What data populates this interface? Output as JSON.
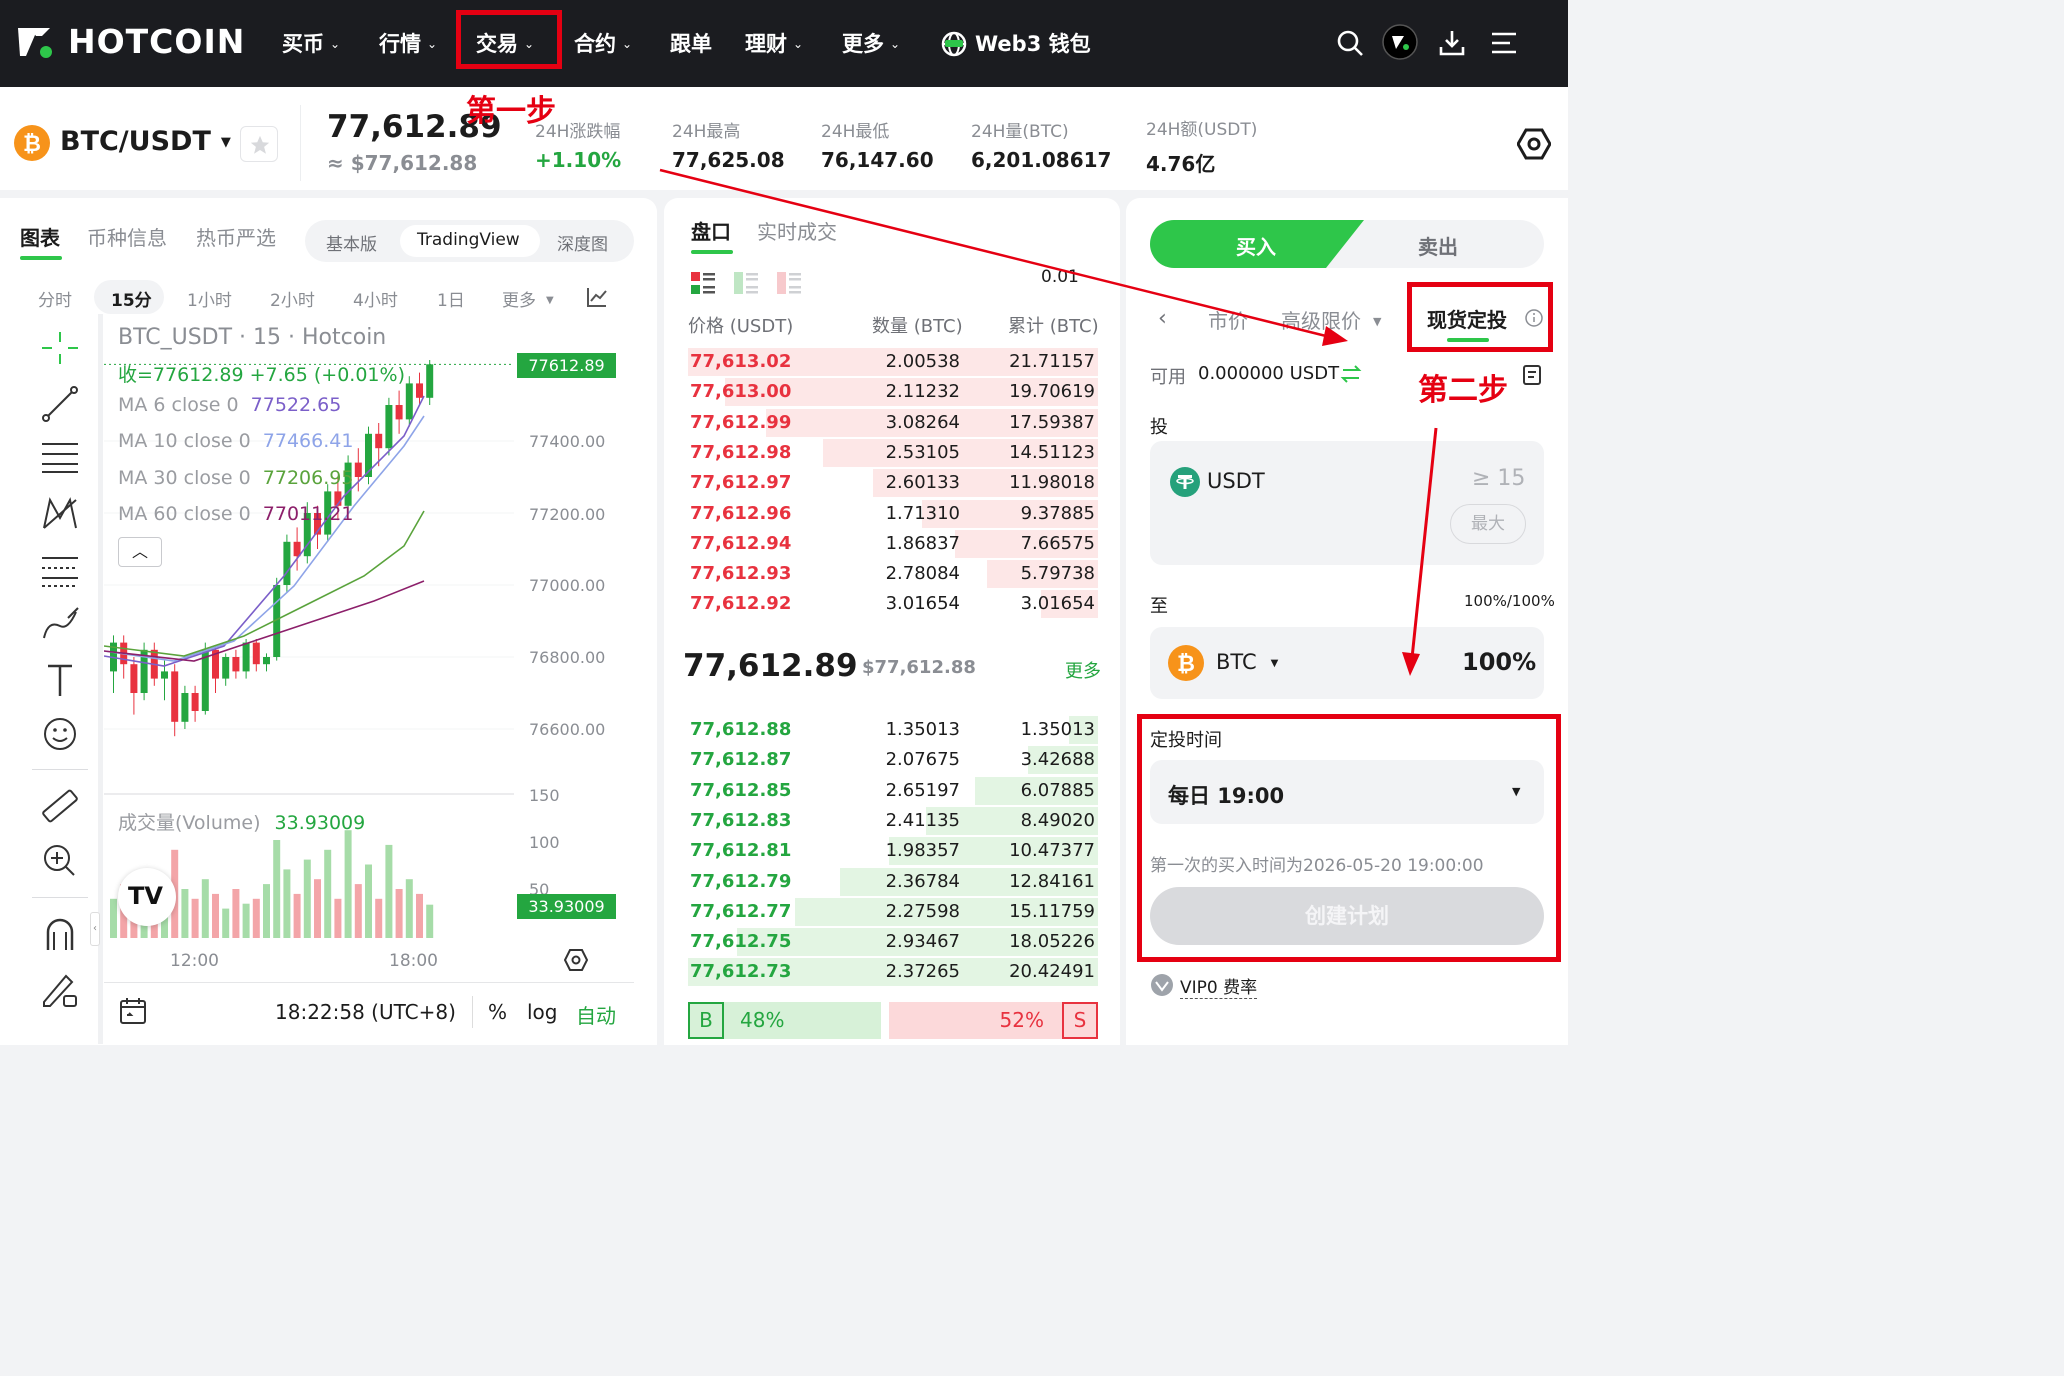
{
  "nav": {
    "logo": "HOTCOIN",
    "items": [
      {
        "label": "买币",
        "has_menu": true
      },
      {
        "label": "行情",
        "has_menu": true
      },
      {
        "label": "交易",
        "has_menu": true
      },
      {
        "label": "合约",
        "has_menu": true
      },
      {
        "label": "跟单",
        "has_menu": false
      },
      {
        "label": "理财",
        "has_menu": true
      },
      {
        "label": "更多",
        "has_menu": true
      }
    ],
    "web3_wallet": "Web3 钱包",
    "chevron": "⌄"
  },
  "annotations": {
    "step1": "第一步",
    "step2": "第二步"
  },
  "ticker": {
    "pair": "BTC/USDT",
    "last_price": "77,612.89",
    "last_price_usd": "≈ $77,612.88",
    "change_label": "24H涨跌幅",
    "change_value": "+1.10%",
    "high_label": "24H最高",
    "high_value": "77,625.08",
    "low_label": "24H最低",
    "low_value": "76,147.60",
    "vol_btc_label": "24H量(BTC)",
    "vol_btc_value": "6,201.08617",
    "vol_usdt_label": "24H额(USDT)",
    "vol_usdt_value": "4.76亿"
  },
  "chart_panel": {
    "tabs": [
      "图表",
      "币种信息",
      "热币严选"
    ],
    "views": [
      "基本版",
      "TradingView",
      "深度图"
    ],
    "active_view": "TradingView",
    "timeframes": [
      "分时",
      "15分",
      "1小时",
      "2小时",
      "4小时",
      "1日",
      "更多"
    ],
    "active_timeframe": "15分",
    "symbol_title": "BTC_USDT · 15 · Hotcoin",
    "ohlc_line": "收=77612.89 +7.65 (+0.01%)",
    "ma": [
      {
        "label": "MA 6 close 0",
        "value": "77522.65",
        "color": "#7b5fc9"
      },
      {
        "label": "MA 10 close 0",
        "value": "77466.41",
        "color": "#8ea4e8"
      },
      {
        "label": "MA 30 close 0",
        "value": "77206.95",
        "color": "#5aa33c"
      },
      {
        "label": "MA 60 close 0",
        "value": "77011.21",
        "color": "#8c1f6a"
      }
    ],
    "price_axis": [
      "77400.00",
      "77200.00",
      "77000.00",
      "76800.00",
      "76600.00"
    ],
    "price_tag": "77612.89",
    "volume_label": "成交量(Volume)",
    "volume_value": "33.93009",
    "volume_axis": [
      "150",
      "100",
      "50"
    ],
    "volume_tag": "33.93009",
    "time_axis": [
      "12:00",
      "18:00"
    ],
    "clock": "18:22:58 (UTC+8)",
    "bottom_controls": [
      "%",
      "log",
      "自动"
    ]
  },
  "orderbook": {
    "tabs": [
      "盘口",
      "实时成交"
    ],
    "precision": "0.01",
    "headers": [
      "价格 (USDT)",
      "数量 (BTC)",
      "累计 (BTC)"
    ],
    "asks": [
      {
        "price": "77,613.02",
        "qty": "2.00538",
        "total": "21.71157",
        "depth": 1.0
      },
      {
        "price": "77,613.00",
        "qty": "2.11232",
        "total": "19.70619",
        "depth": 0.91
      },
      {
        "price": "77,612.99",
        "qty": "3.08264",
        "total": "17.59387",
        "depth": 0.81
      },
      {
        "price": "77,612.98",
        "qty": "2.53105",
        "total": "14.51123",
        "depth": 0.67
      },
      {
        "price": "77,612.97",
        "qty": "2.60133",
        "total": "11.98018",
        "depth": 0.55
      },
      {
        "price": "77,612.96",
        "qty": "1.71310",
        "total": "9.37885",
        "depth": 0.43
      },
      {
        "price": "77,612.94",
        "qty": "1.86837",
        "total": "7.66575",
        "depth": 0.35
      },
      {
        "price": "77,612.93",
        "qty": "2.78084",
        "total": "5.79738",
        "depth": 0.27
      },
      {
        "price": "77,612.92",
        "qty": "3.01654",
        "total": "3.01654",
        "depth": 0.14
      }
    ],
    "mid_price": "77,612.89",
    "mid_price_usd": "$77,612.88",
    "more": "更多",
    "bids": [
      {
        "price": "77,612.88",
        "qty": "1.35013",
        "total": "1.35013",
        "depth": 0.07
      },
      {
        "price": "77,612.87",
        "qty": "2.07675",
        "total": "3.42688",
        "depth": 0.17
      },
      {
        "price": "77,612.85",
        "qty": "2.65197",
        "total": "6.07885",
        "depth": 0.3
      },
      {
        "price": "77,612.83",
        "qty": "2.41135",
        "total": "8.49020",
        "depth": 0.42
      },
      {
        "price": "77,612.81",
        "qty": "1.98357",
        "total": "10.47377",
        "depth": 0.51
      },
      {
        "price": "77,612.79",
        "qty": "2.36784",
        "total": "12.84161",
        "depth": 0.63
      },
      {
        "price": "77,612.77",
        "qty": "2.27598",
        "total": "15.11759",
        "depth": 0.74
      },
      {
        "price": "77,612.75",
        "qty": "2.93467",
        "total": "18.05226",
        "depth": 0.88
      },
      {
        "price": "77,612.73",
        "qty": "2.37265",
        "total": "20.42491",
        "depth": 1.0
      }
    ],
    "buy_ratio_label": "B",
    "buy_ratio": "48%",
    "sell_ratio": "52%",
    "sell_ratio_label": "S",
    "buy_ratio_value": 0.48
  },
  "trade": {
    "buy": "买入",
    "sell": "卖出",
    "order_types": [
      "市价",
      "高级限价",
      "现货定投"
    ],
    "active_order_type": "现货定投",
    "available_label": "可用",
    "available_value": "0.000000 USDT",
    "invest_label": "投",
    "invest_coin": "USDT",
    "invest_amount_placeholder": "≥ 15",
    "max": "最大",
    "to_label": "至",
    "to_ratio": "100%/100%",
    "to_coin": "BTC",
    "to_percent": "100%",
    "schedule_label": "定投时间",
    "schedule_value": "每日 19:00",
    "first_buy_note": "第一次的买入时间为2026-05-20 19:00:00",
    "create_plan": "创建计划",
    "fee_label": "VIP0 费率"
  },
  "colors": {
    "up": "#24a640",
    "down": "#e8323f",
    "ask_bar": "#fde7e7",
    "bid_bar": "#e3f5e3",
    "highlight": "#e50012",
    "brand_green": "#2ec64a"
  }
}
